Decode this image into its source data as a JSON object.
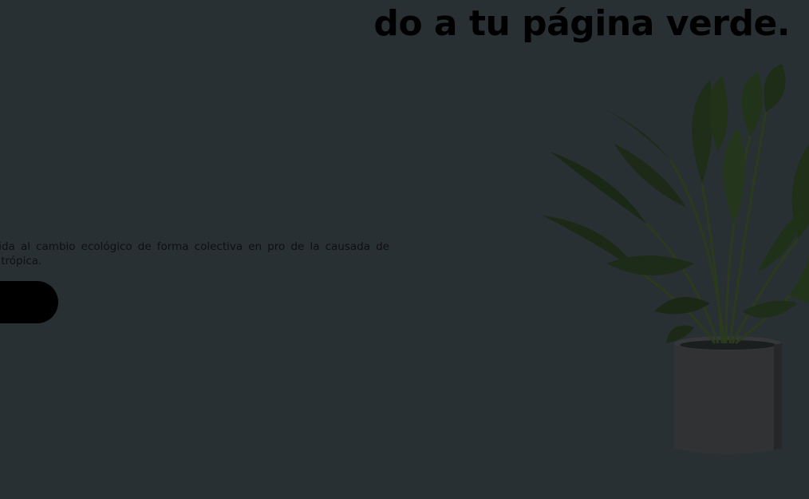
{
  "hero": {
    "title": "do a tu página verde.",
    "description": "omprometida al cambio ecológico de forma colectiva en pro de la causada de manera antrópica.",
    "cta_label": ""
  },
  "image": {
    "plant_icon": "potted-plant-icon"
  },
  "colors": {
    "background": "#293033",
    "text": "#000000",
    "button": "#000000"
  }
}
